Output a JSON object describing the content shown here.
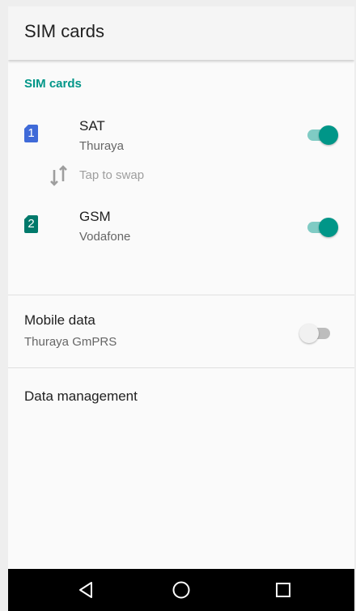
{
  "appbar": {
    "title": "SIM cards"
  },
  "section": {
    "header": "SIM cards"
  },
  "sims": [
    {
      "slot": "1",
      "name": "SAT",
      "carrier": "Thuraya",
      "enabled": true,
      "badge_color": "#3f6ad8"
    },
    {
      "slot": "2",
      "name": "GSM",
      "carrier": "Vodafone",
      "enabled": true,
      "badge_color": "#00796b"
    }
  ],
  "swap": {
    "label": "Tap to swap"
  },
  "mobile_data": {
    "title": "Mobile data",
    "subtitle": "Thuraya GmPRS",
    "enabled": false
  },
  "data_management": {
    "title": "Data management"
  },
  "navbar": {
    "back": "back-icon",
    "home": "home-icon",
    "recents": "recents-icon"
  },
  "colors": {
    "accent": "#009688",
    "accent_track": "#80cbc4",
    "navbar_bg": "#000000"
  }
}
